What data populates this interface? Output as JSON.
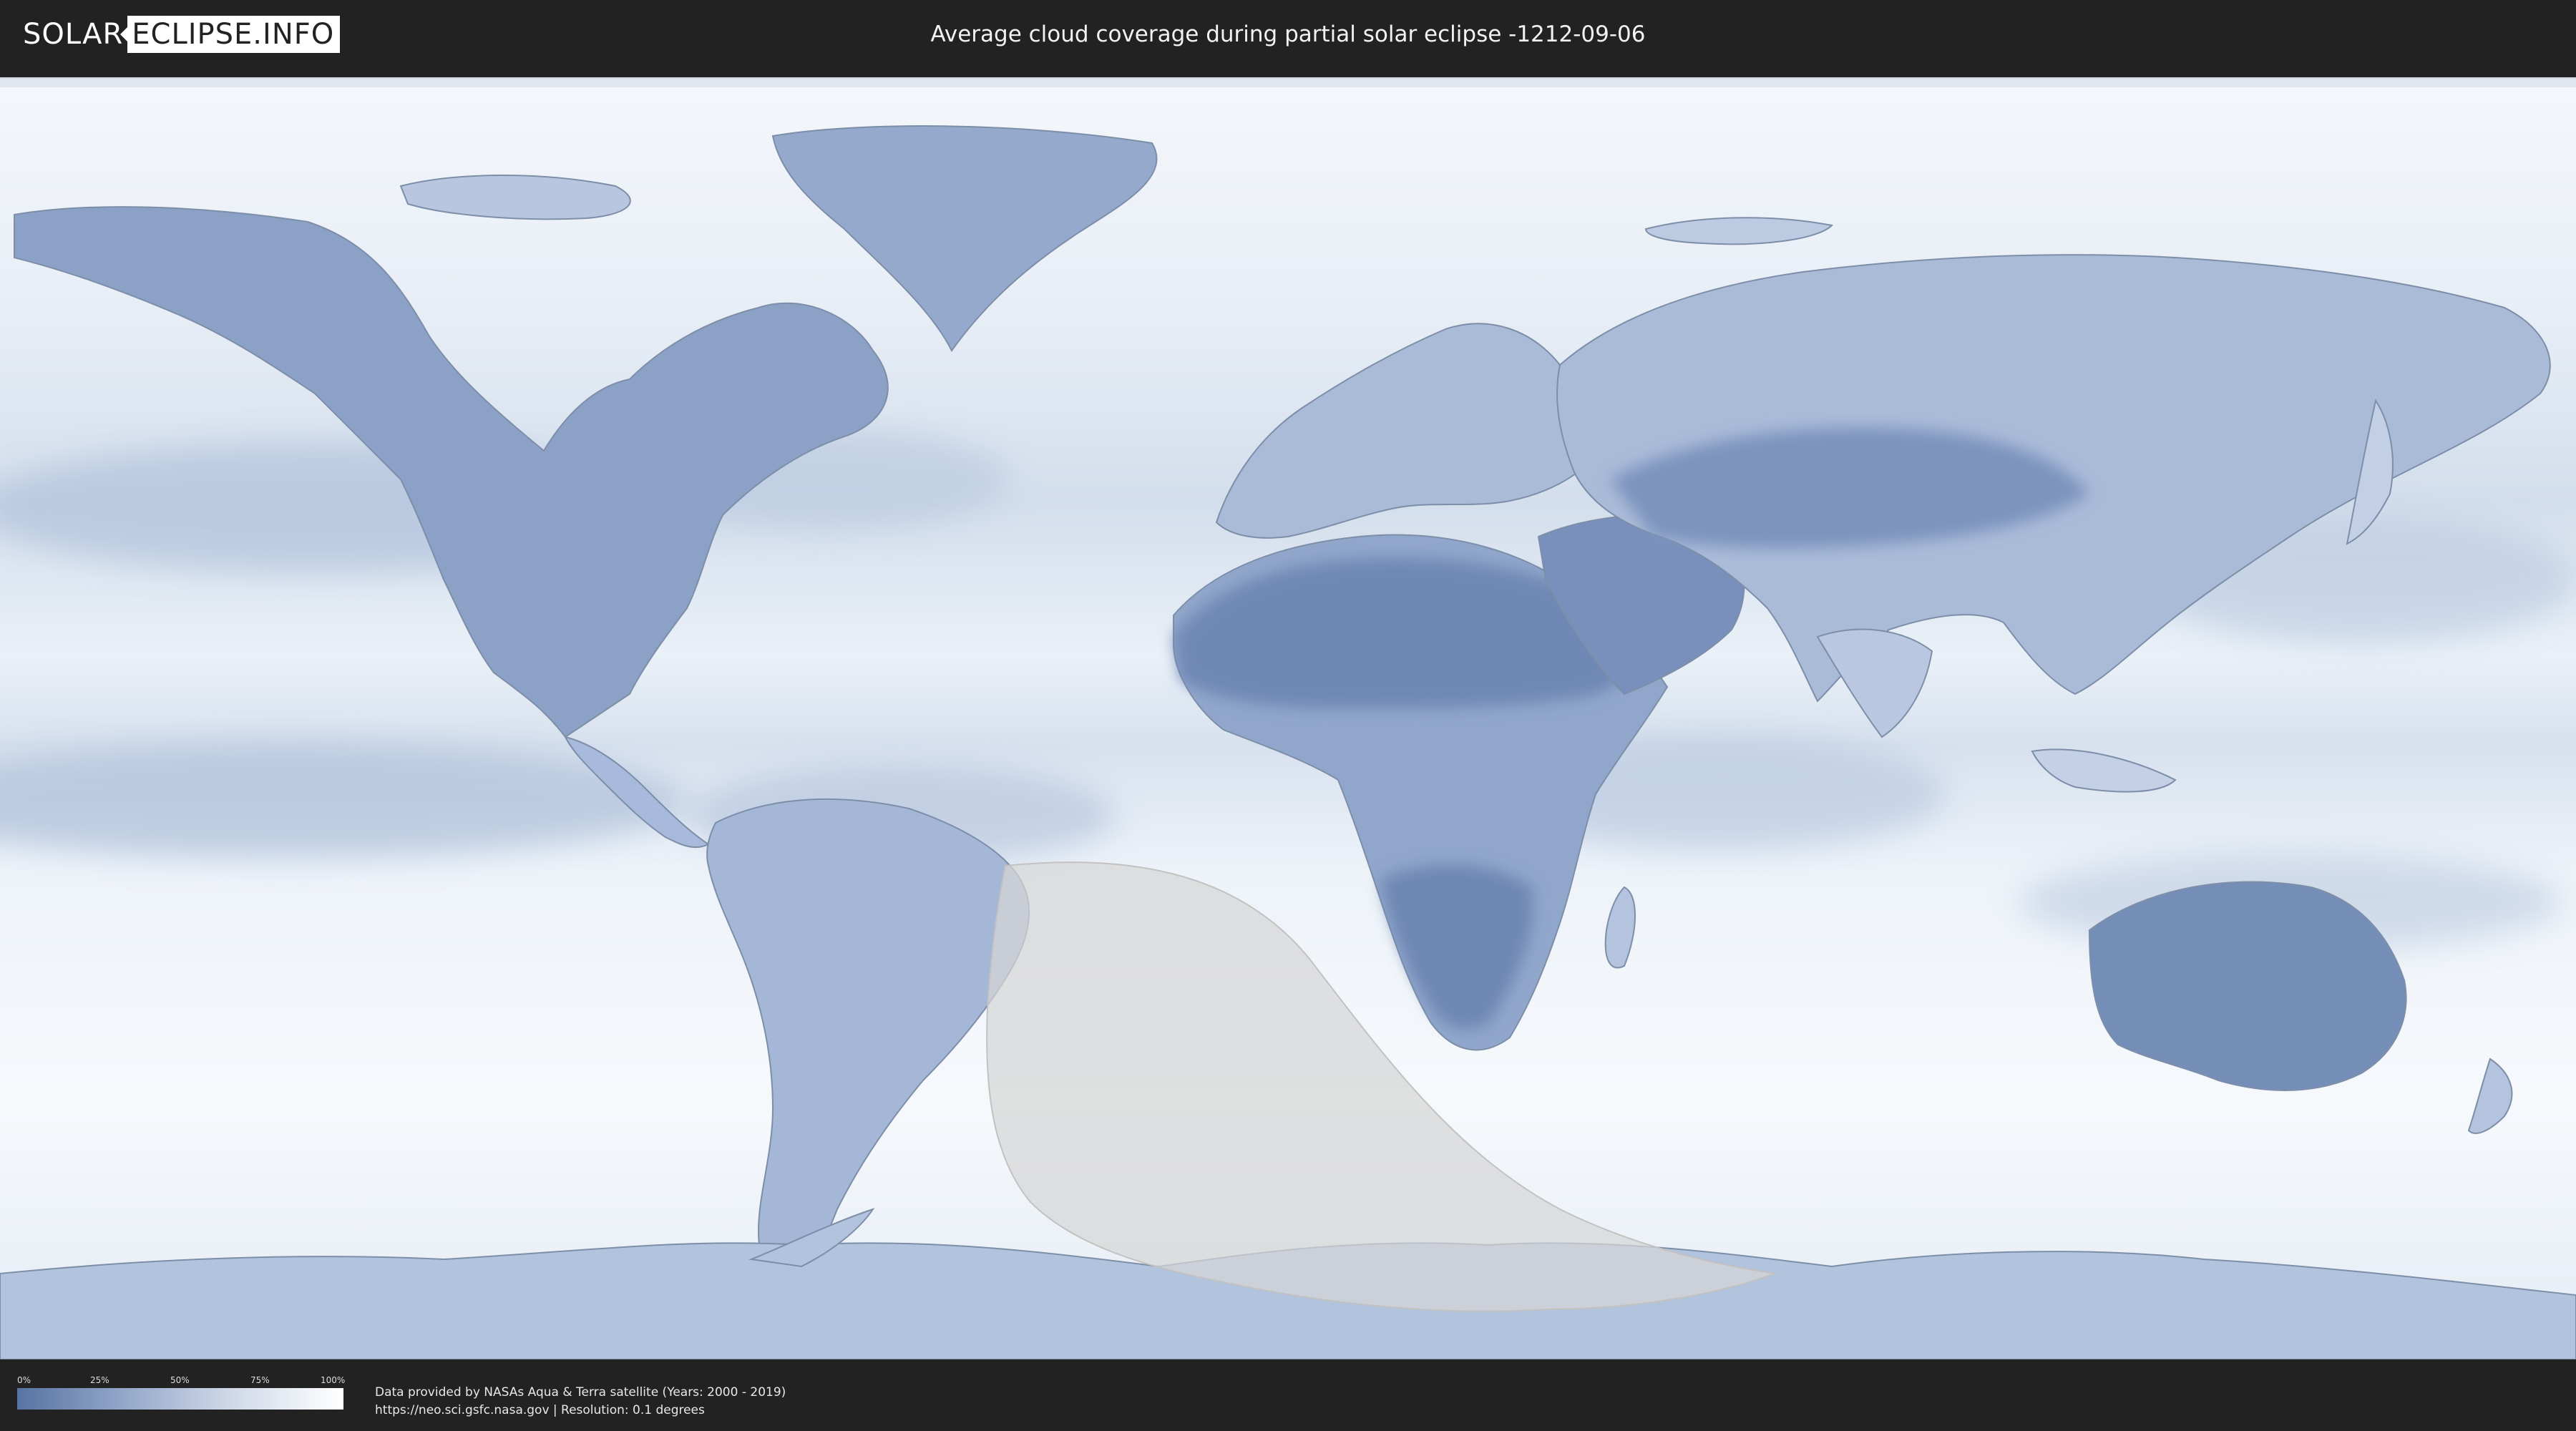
{
  "header": {
    "logo_part1": "SOLAR",
    "logo_part2": "ECLIPSE.INFO",
    "title": "Average cloud coverage during partial solar eclipse -1212-09-06"
  },
  "map": {
    "projection": "equirectangular",
    "colors": {
      "ocean_cloudy": "#eef3f9",
      "cloud_medium": "#a9bbd6",
      "clear_sky": "#5873a3",
      "eclipse_zone": "#d9d9d9"
    },
    "regions": [
      {
        "name": "north-america",
        "coverage": "low"
      },
      {
        "name": "sahara-arabia",
        "coverage": "very-low"
      },
      {
        "name": "southern-africa",
        "coverage": "low"
      },
      {
        "name": "australia",
        "coverage": "low"
      },
      {
        "name": "greenland",
        "coverage": "low"
      },
      {
        "name": "south-america",
        "coverage": "medium"
      },
      {
        "name": "antarctica",
        "coverage": "medium"
      }
    ]
  },
  "legend": {
    "ticks": [
      "0%",
      "25%",
      "50%",
      "75%",
      "100%"
    ],
    "gradient_from": "#5873a3",
    "gradient_to": "#ffffff"
  },
  "footer": {
    "credit_line1": "Data provided by NASAs Aqua & Terra satellite (Years: 2000 - 2019)",
    "credit_line2": "https://neo.sci.gsfc.nasa.gov | Resolution: 0.1 degrees"
  }
}
